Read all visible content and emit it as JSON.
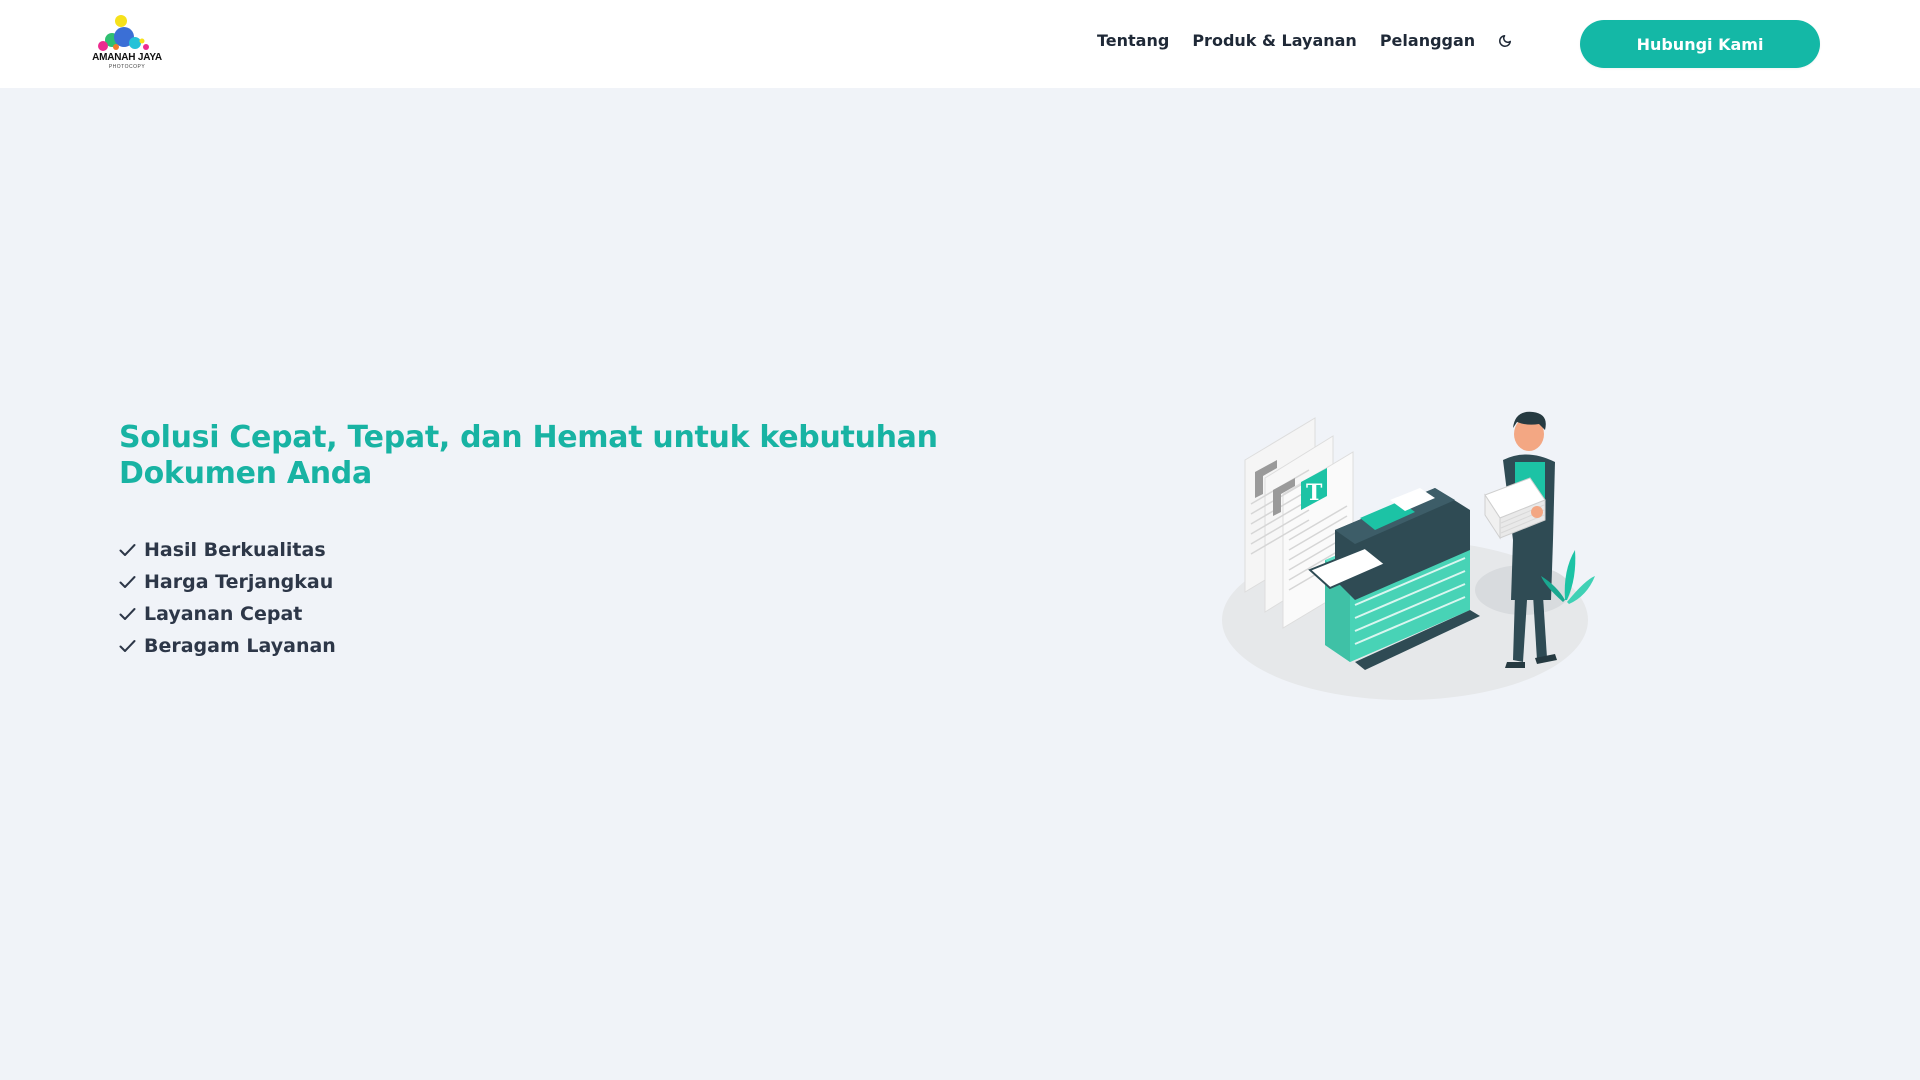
{
  "brand": {
    "name": "AMANAH JAYA",
    "tagline": "PHOTOCOPY"
  },
  "nav": {
    "links": [
      {
        "label": "Tentang"
      },
      {
        "label": "Produk & Layanan"
      },
      {
        "label": "Pelanggan"
      }
    ],
    "theme_toggle_icon": "moon-icon",
    "cta_label": "Hubungi Kami"
  },
  "hero": {
    "title": "Solusi Cepat, Tepat, dan Hemat untuk kebutuhan Dokumen Anda",
    "features": [
      {
        "label": "Hasil Berkualitas",
        "icon": "check-icon"
      },
      {
        "label": "Harga Terjangkau",
        "icon": "check-icon"
      },
      {
        "label": "Layanan Cepat",
        "icon": "check-icon"
      },
      {
        "label": "Beragam Layanan",
        "icon": "check-icon"
      }
    ],
    "illustration_icon": "photocopier-illustration"
  },
  "colors": {
    "accent": "#14b8a6",
    "title": "#18b3a3",
    "background": "#f0f3f8",
    "navbar": "#ffffff",
    "text": "#1f2937"
  }
}
